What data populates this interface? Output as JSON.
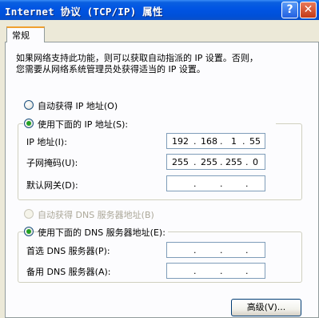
{
  "window": {
    "title": "Internet 协议 (TCP/IP) 属性"
  },
  "tabs": [
    {
      "label": "常规"
    }
  ],
  "description": {
    "line1": "如果网络支持此功能，则可以获取自动指派的 IP 设置。否则，",
    "line2": "您需要从网络系统管理员处获得适当的 IP 设置。"
  },
  "ip_section": {
    "auto_label": "自动获得 IP 地址(O)",
    "manual_label": "使用下面的 IP 地址(S):",
    "selected": "manual",
    "fields": [
      {
        "label": "IP 地址(I):",
        "value": [
          "192",
          "168",
          "1",
          "55"
        ]
      },
      {
        "label": "子网掩码(U):",
        "value": [
          "255",
          "255",
          "255",
          "0"
        ]
      },
      {
        "label": "默认网关(D):",
        "value": [
          "",
          "",
          "",
          ""
        ]
      }
    ]
  },
  "dns_section": {
    "auto_label": "自动获得 DNS 服务器地址(B)",
    "auto_enabled": false,
    "manual_label": "使用下面的 DNS 服务器地址(E):",
    "selected": "manual",
    "fields": [
      {
        "label": "首选 DNS 服务器(P):",
        "value": [
          "",
          "",
          "",
          ""
        ]
      },
      {
        "label": "备用 DNS 服务器(A):",
        "value": [
          "",
          "",
          "",
          ""
        ]
      }
    ]
  },
  "buttons": {
    "advanced": "高级(V)..."
  },
  "title_buttons": {
    "help": "?",
    "close": "✕"
  }
}
